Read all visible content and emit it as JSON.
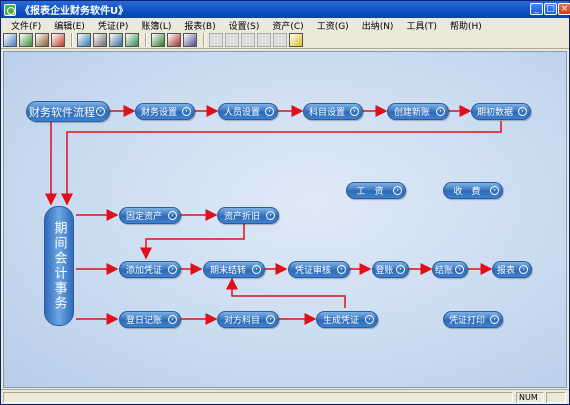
{
  "window": {
    "title": "《报表企业财务软件U》"
  },
  "menu": [
    "文件(F)",
    "编辑(E)",
    "凭证(P)",
    "账簿(L)",
    "报表(B)",
    "设置(S)",
    "资产(C)",
    "工资(G)",
    "出纳(N)",
    "工具(T)",
    "帮助(H)"
  ],
  "toolbar_icons": [
    "open-icon",
    "print-icon",
    "edit-icon",
    "save-icon",
    "search-icon",
    "export-icon",
    "table-icon",
    "chart-icon",
    "report-icon",
    "image-icon",
    "disk-icon",
    "cut-icon",
    "scissors-icon",
    "copy-icon",
    "paste-icon",
    "help-icon"
  ],
  "flow": {
    "main": "财务软件流程",
    "setup": [
      "财务设置",
      "人员设置",
      "科目设置",
      "创建新账",
      "期初数据"
    ],
    "period": "期间会计事务",
    "aux": [
      "工　资",
      "收　费"
    ],
    "row1": [
      "固定资产",
      "资产折旧"
    ],
    "row2": [
      "添加凭证",
      "期末结转",
      "凭证审核",
      "登账",
      "结账",
      "报表"
    ],
    "row3": [
      "登日记账",
      "对方科目",
      "生成凭证",
      "凭证打印"
    ]
  },
  "status": {
    "num": "NUM"
  },
  "colors": {
    "arrow": "#e0101a",
    "node": "#2e6bb8",
    "canvas": "#c9daf0"
  }
}
